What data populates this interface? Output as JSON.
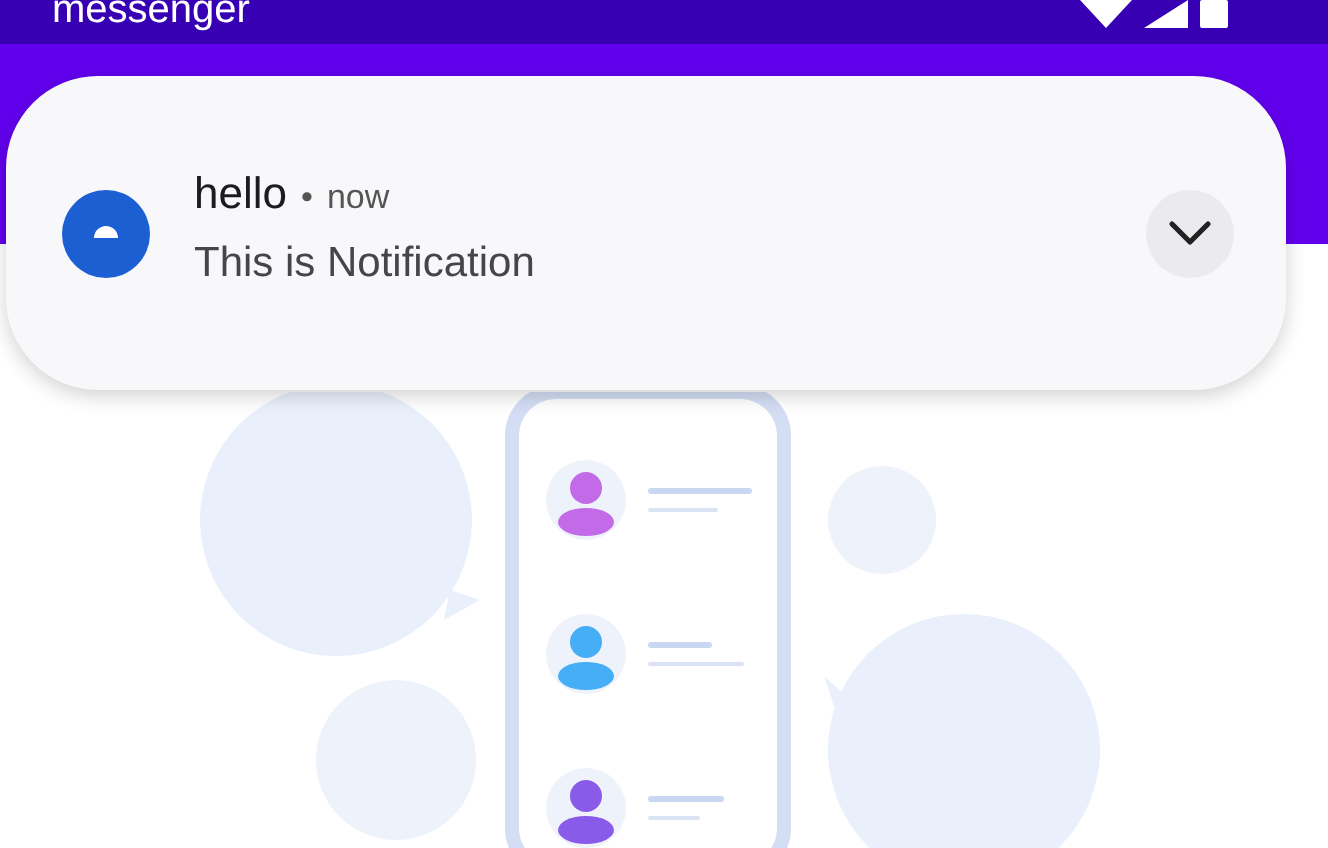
{
  "status_bar": {
    "app_name": "messenger"
  },
  "notification": {
    "title": "hello",
    "separator": "•",
    "time": "now",
    "text": "This is Notification",
    "expanded": false
  }
}
